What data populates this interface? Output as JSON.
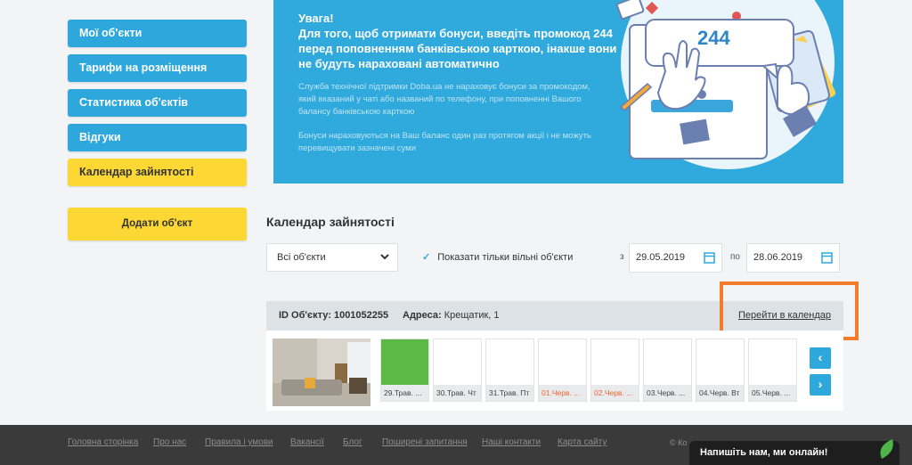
{
  "sidebar": {
    "items": [
      {
        "label": "Мої об'єкти"
      },
      {
        "label": "Тарифи на розміщення"
      },
      {
        "label": "Статистика об'єктів"
      },
      {
        "label": "Відгуки"
      },
      {
        "label": "Календар зайнятості"
      }
    ],
    "add_label": "Додати об'єкт"
  },
  "banner": {
    "title": "Увага!\nДля того, щоб отримати бонуси, введіть промокод 244 перед поповненням банківською карткою, інакше вони не будуть нараховані автоматично",
    "text1": "Служба технічної підтримки Doba.ua не нараховує бонуси за промокодом, який вказаний у чаті або названий по телефону, при поповненні Вашого балансу банківською карткою",
    "text2": "Бонуси нараховуються на Ваш баланс один раз протягом акції і не можуть перевищувати зазначені суми",
    "promo_code": "244"
  },
  "calendar": {
    "title": "Календар зайнятості",
    "filter_value": "Всі об'єкти",
    "free_only_label": "Показати тільки вільні об'єкти",
    "from_label": "з",
    "from_date": "29.05.2019",
    "to_label": "по",
    "to_date": "28.06.2019",
    "object_id": "ID Об'єкту: 1001052255",
    "address_label": "Адреса:",
    "address_value": "Крещатик, 1",
    "go_link": "Перейти в календар",
    "days": [
      {
        "label": "29.Трав. ...",
        "color": "#5cb946",
        "weekend": false
      },
      {
        "label": "30.Трав. Чт",
        "color": "#ffffff",
        "weekend": false
      },
      {
        "label": "31.Трав. Пт",
        "color": "#ffffff",
        "weekend": false
      },
      {
        "label": "01.Черв. ...",
        "color": "#ffffff",
        "weekend": true
      },
      {
        "label": "02.Черв. ...",
        "color": "#ffffff",
        "weekend": true
      },
      {
        "label": "03.Черв. ...",
        "color": "#ffffff",
        "weekend": false
      },
      {
        "label": "04.Черв. Вт",
        "color": "#ffffff",
        "weekend": false
      },
      {
        "label": "05.Черв. ...",
        "color": "#ffffff",
        "weekend": false
      }
    ],
    "prev_icon": "chevron-left-icon",
    "next_icon": "chevron-right-icon"
  },
  "footer": {
    "links": [
      {
        "label": "Головна сторінка"
      },
      {
        "label": "Про нас"
      },
      {
        "label": "Правила і умови"
      },
      {
        "label": "Вакансії"
      },
      {
        "label": "Блог"
      },
      {
        "label": "Поширені запитання"
      },
      {
        "label": "Наші контакти"
      },
      {
        "label": "Карта сайту"
      }
    ],
    "copyright": "© Ко"
  },
  "chat": {
    "label": "Напишіть нам, ми онлайн!"
  },
  "colors": {
    "accent": "#2ea8dc",
    "active": "#fdd835",
    "highlight": "#f47b2c",
    "busy": "#5cb946"
  }
}
